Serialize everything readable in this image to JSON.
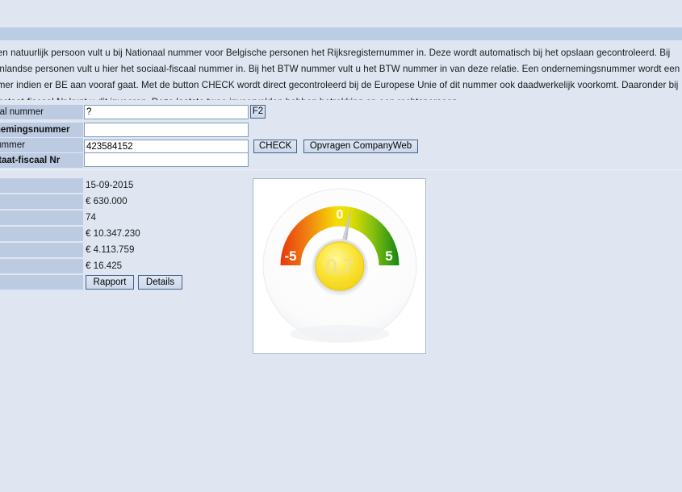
{
  "page": {
    "background_color": "#dfe6f2",
    "band_color": "#bbcce5"
  },
  "description": {
    "text": "Bij een natuurlijk persoon vult u bij Nationaal nummer voor Belgische personen het Rijksregisternummer in. Deze wordt automatisch bij het opslaan gecontroleerd. Bij buitenlandse personen vult u hier het sociaal-fiscaal nummer in. Bij het BTW nummer vult u het BTW nummer in van deze relatie. Een ondernemingsnummer wordt een BTW nummer indien er BE aan vooraf gaat. Met de button CHECK wordt direct gecontroleerd bij de Europese Unie of dit nummer ook daadwerkelijk voorkomt. Daaronder bij Woonstaat-fiscaal Nr kunt u dit invoeren. Deze laatste twee invoervelden hebben betrekking op een rechtspersoon."
  },
  "form": {
    "rows": [
      {
        "label": "Nationaal nummer",
        "label_bold": false,
        "value": "?",
        "placeholder": "",
        "button": "F2"
      },
      {
        "label": "Ondernemingsnummer",
        "label_bold": true,
        "value": "",
        "placeholder": "",
        "button": ""
      },
      {
        "label": "BTW nummer",
        "label_bold": false,
        "value": "423584152",
        "placeholder": "",
        "button": "CHECK",
        "button2": "Opvragen CompanyWeb"
      },
      {
        "label": "Woonstaat-fiscaal Nr",
        "label_bold": true,
        "value": "",
        "placeholder": "",
        "button": ""
      }
    ]
  },
  "data_table": {
    "rows": [
      {
        "label": "",
        "value": "15-09-2015"
      },
      {
        "label": "",
        "value": "€ 630.000"
      },
      {
        "label": "",
        "value": "74"
      },
      {
        "label": "",
        "value": "€ 10.347.230"
      },
      {
        "label": "",
        "value": "€ 4.113.759"
      },
      {
        "label": "",
        "value": "€ 16.425"
      }
    ],
    "buttons": {
      "report": "Rapport",
      "details": "Details"
    }
  },
  "gauge": {
    "type": "gauge",
    "value": "0,7",
    "value_numeric": 0.7,
    "min_label": "-5",
    "max_label": "5",
    "mid_label": "0",
    "min": -5,
    "max": 5,
    "colors": {
      "low": "#e8380d",
      "mid": "#f2e500",
      "high": "#1d9b1d",
      "hub": "#f7e021"
    }
  }
}
